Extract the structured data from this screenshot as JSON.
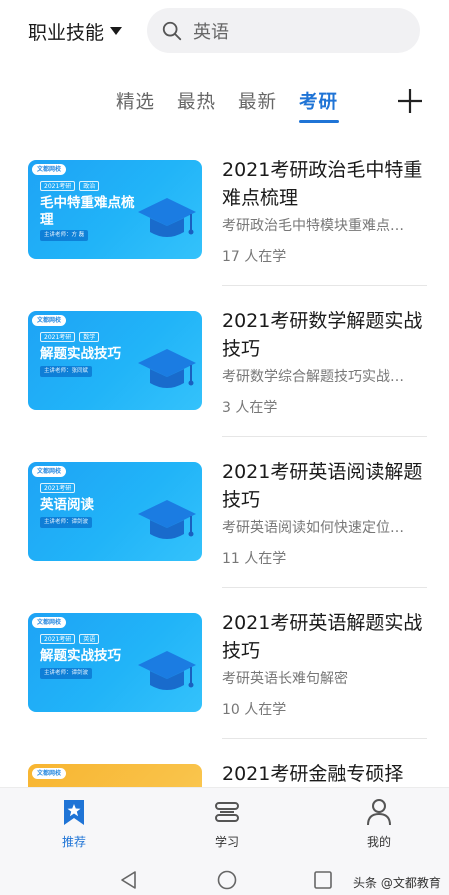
{
  "header": {
    "category_label": "职业技能",
    "search_text": "英语"
  },
  "tabs": [
    {
      "label": "精选",
      "active": false
    },
    {
      "label": "最热",
      "active": false
    },
    {
      "label": "最新",
      "active": false
    },
    {
      "label": "考研",
      "active": true
    }
  ],
  "courses": [
    {
      "title": "2021考研政治毛中特重难点梳理",
      "desc": "考研政治毛中特模块重难点…",
      "count": "17 人在学",
      "thumb": {
        "brand": "文都网校",
        "tags": [
          "2021考研",
          "政治"
        ],
        "title": "毛中特重难点梳理",
        "teacher": "主讲老师：方 磊"
      }
    },
    {
      "title": "2021考研数学解题实战技巧",
      "desc": "考研数学综合解题技巧实战…",
      "count": "3 人在学",
      "thumb": {
        "brand": "文都网校",
        "tags": [
          "2021考研",
          "数学"
        ],
        "title": "解题实战技巧",
        "teacher": "主讲老师：张同斌"
      }
    },
    {
      "title": "2021考研英语阅读解题技巧",
      "desc": "考研英语阅读如何快速定位…",
      "count": "11 人在学",
      "thumb": {
        "brand": "文都网校",
        "tags": [
          "2021考研"
        ],
        "title": "英语阅读",
        "teacher": "主讲老师：谭剑波"
      }
    },
    {
      "title": "2021考研英语解题实战技巧",
      "desc": "考研英语长难句解密",
      "count": "10 人在学",
      "thumb": {
        "brand": "文都网校",
        "tags": [
          "2021考研",
          "英语"
        ],
        "title": "解题实战技巧",
        "teacher": "主讲老师：谭剑波"
      }
    },
    {
      "title": "2021考研金融专硕择",
      "desc": "",
      "count": "",
      "thumb": {
        "brand": "文都网校",
        "tags": [],
        "title": "",
        "teacher": ""
      }
    }
  ],
  "bottom_nav": [
    {
      "label": "推荐",
      "icon": "bookmark-star-icon",
      "active": true
    },
    {
      "label": "学习",
      "icon": "book-stack-icon",
      "active": false
    },
    {
      "label": "我的",
      "icon": "person-icon",
      "active": false
    }
  ],
  "watermark": "头条 @文都教育",
  "colors": {
    "accent": "#1f74d6",
    "thumb_blue": "#21b4f8",
    "thumb_orange": "#f9c248"
  }
}
